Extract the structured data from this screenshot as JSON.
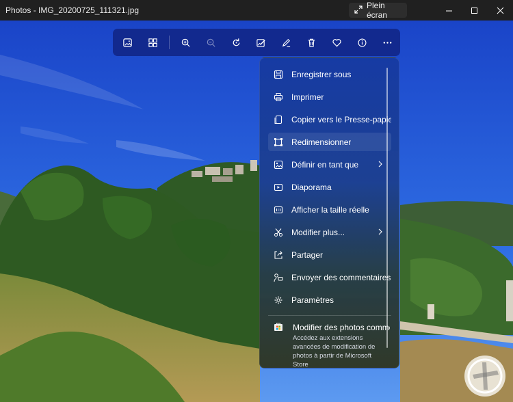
{
  "window": {
    "title": "Photos - IMG_20200725_111321.jpg",
    "fullscreen_label": "Plein écran"
  },
  "toolbar": {
    "buttons": [
      {
        "name": "photo-view-icon"
      },
      {
        "name": "gallery-icon"
      },
      {
        "name": "zoom-in-icon"
      },
      {
        "name": "zoom-out-icon"
      },
      {
        "name": "rotate-icon"
      },
      {
        "name": "edit-image-icon"
      },
      {
        "name": "markup-icon"
      },
      {
        "name": "delete-icon"
      },
      {
        "name": "favorite-icon"
      },
      {
        "name": "info-icon"
      },
      {
        "name": "more-icon"
      }
    ]
  },
  "menu": {
    "items": [
      {
        "label": "Enregistrer sous",
        "icon": "save-icon"
      },
      {
        "label": "Imprimer",
        "icon": "print-icon"
      },
      {
        "label": "Copier vers le Presse-papiers",
        "icon": "copy-icon"
      },
      {
        "label": "Redimensionner",
        "icon": "resize-icon"
      },
      {
        "label": "Définir en tant que",
        "icon": "set-as-icon",
        "submenu": true
      },
      {
        "label": "Diaporama",
        "icon": "slideshow-icon"
      },
      {
        "label": "Afficher la taille réelle",
        "icon": "actual-size-icon"
      },
      {
        "label": "Modifier plus...",
        "icon": "edit-more-icon",
        "submenu": true
      },
      {
        "label": "Partager",
        "icon": "share-icon"
      },
      {
        "label": "Envoyer des commentaires",
        "icon": "feedback-icon"
      },
      {
        "label": "Paramètres",
        "icon": "settings-icon"
      }
    ],
    "store": {
      "title": "Modifier des photos comme",
      "description": "Accédez aux extensions avancées de modification de photos à partir de Microsoft Store"
    }
  },
  "colors": {
    "toolbar": "#12268c",
    "menu_top": "#163aa0",
    "sky": "#1f4fd6"
  }
}
